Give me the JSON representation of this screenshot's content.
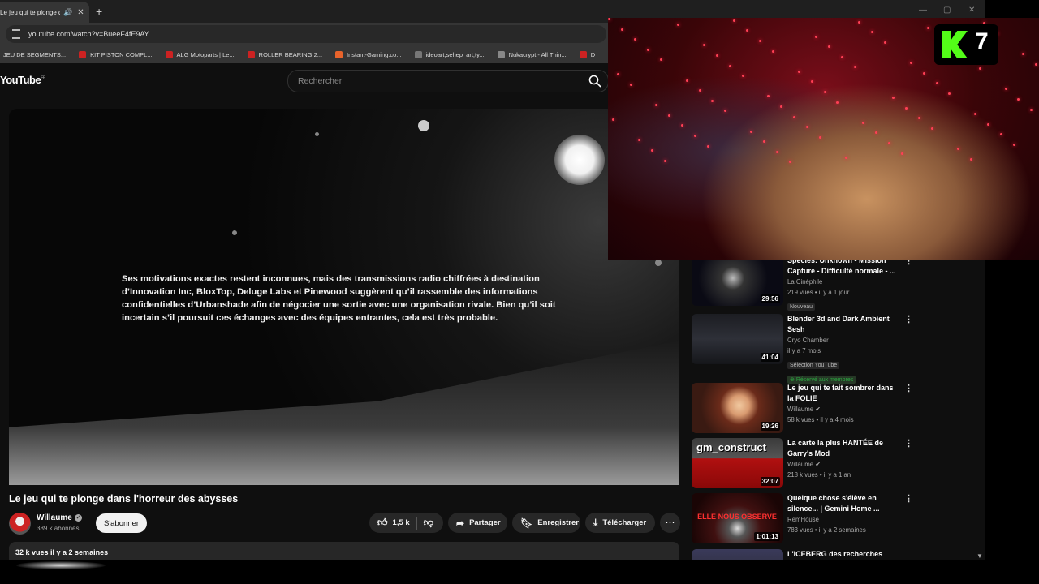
{
  "browser": {
    "tab_title": "Le jeu qui te plonge dans",
    "url": "youtube.com/watch?v=BueeF4fE9AY",
    "bookmarks": [
      {
        "label": "JEU DE SEGMENTS...",
        "color": "#555555"
      },
      {
        "label": "KIT PISTON COMPL...",
        "color": "#cc2222"
      },
      {
        "label": "ALG Motoparts | Le...",
        "color": "#cc2222"
      },
      {
        "label": "ROLLER BEARING 2...",
        "color": "#cc2222"
      },
      {
        "label": "Instant-Gaming.co...",
        "color": "#e8632b"
      },
      {
        "label": "ideoart,sehep_art,ty...",
        "color": "#777777"
      },
      {
        "label": "Nukacrypt - All Thin...",
        "color": "#888888"
      },
      {
        "label": "D",
        "color": "#cc2222"
      }
    ]
  },
  "youtube": {
    "logo": "YouTube",
    "logo_region": "FR",
    "search_placeholder": "Rechercher"
  },
  "video": {
    "subtitle": "Ses motivations exactes restent inconnues, mais des transmissions radio chiffrées à destination d’Innovation Inc, BloxTop, Deluge Labs et Pinewood suggèrent qu’il rassemble des informations confidentielles d’Urbanshade afin de négocier une sortie avec une organisation rivale. Bien qu’il soit incertain s’il poursuit ces échanges avec des équipes entrantes, cela est très probable.",
    "title": "Le jeu qui te plonge dans l'horreur des abysses",
    "channel": "Willaume",
    "subscribers": "389 k abonnés",
    "subscribe_label": "S'abonner",
    "likes": "1,5 k",
    "share_label": "Partager",
    "save_label": "Enregistrer",
    "download_label": "Télécharger",
    "views_date": "32 k vues  il y a 2 semaines"
  },
  "sidebar": [
    {
      "title": "Species: Unknown - Mission Capture - Difficulté normale - ...",
      "channel": "La Cinéphile",
      "meta": "219 vues • il y a 1 jour",
      "badge": "Nouveau",
      "duration": "29:56"
    },
    {
      "title": "Blender 3d and Dark Ambient Sesh",
      "channel": "Cryo Chamber",
      "meta": "il y a 7 mois",
      "badge": "Sélection YouTube",
      "member": "Réservé aux membres",
      "duration": "41:04"
    },
    {
      "title": "Le jeu qui te fait sombrer dans la FOLIE",
      "channel": "Willaume",
      "meta": "58 k vues • il y a 4 mois",
      "duration": "19:26"
    },
    {
      "title": "La carte la plus HANTÉE de Garry's Mod",
      "channel": "Willaume",
      "meta": "218 k vues • il y a 1 an",
      "duration": "32:07",
      "thumb_text": "gm_construct"
    },
    {
      "title": "Quelque chose s'élève en silence... | Gemini Home ...",
      "channel": "RemHouse",
      "meta": "783 vues • il y a 2 semaines",
      "duration": "1:01:13",
      "thumb_text": "ELLE NOUS OBSERVE"
    },
    {
      "title": "L'ICEBERG des recherches"
    }
  ],
  "overlay": {
    "kick_number": "7"
  }
}
